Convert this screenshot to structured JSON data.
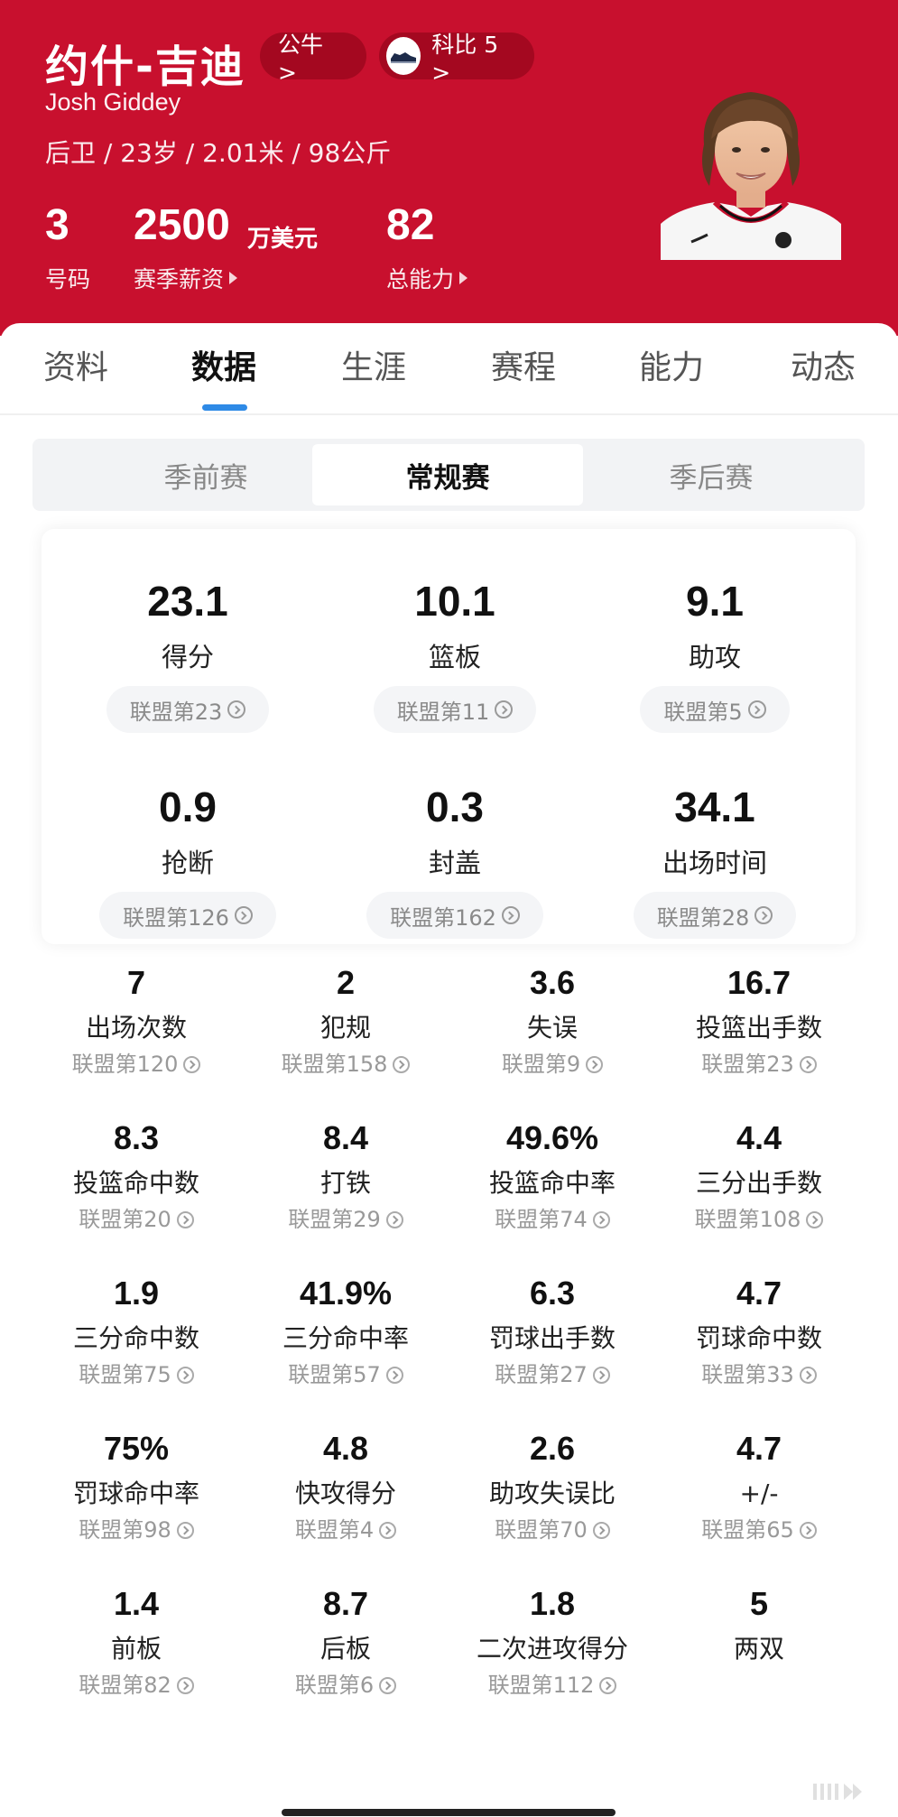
{
  "player": {
    "name_cn": "约什-吉迪",
    "name_en": "Josh Giddey",
    "team_chip": "公牛 >",
    "shoe_chip": "科比 5 >",
    "bio": "后卫 / 23岁 / 2.01米 / 98公斤",
    "number": "3",
    "number_label": "号码",
    "salary": "2500",
    "salary_unit": "万美元",
    "salary_label": "赛季薪资",
    "rating": "82",
    "rating_label": "总能力",
    "brand_color": "#c8102e"
  },
  "tabs": [
    "资料",
    "数据",
    "生涯",
    "赛程",
    "能力",
    "动态"
  ],
  "active_tab": "数据",
  "season_types": [
    "季前赛",
    "常规赛",
    "季后赛"
  ],
  "active_season_type": "常规赛",
  "main_stats": [
    {
      "value": "23.1",
      "label": "得分",
      "rank": "联盟第23"
    },
    {
      "value": "10.1",
      "label": "篮板",
      "rank": "联盟第11"
    },
    {
      "value": "9.1",
      "label": "助攻",
      "rank": "联盟第5"
    },
    {
      "value": "0.9",
      "label": "抢断",
      "rank": "联盟第126"
    },
    {
      "value": "0.3",
      "label": "封盖",
      "rank": "联盟第162"
    },
    {
      "value": "34.1",
      "label": "出场时间",
      "rank": "联盟第28"
    }
  ],
  "detail_stats": [
    {
      "value": "7",
      "label": "出场次数",
      "rank": "联盟第120"
    },
    {
      "value": "2",
      "label": "犯规",
      "rank": "联盟第158"
    },
    {
      "value": "3.6",
      "label": "失误",
      "rank": "联盟第9"
    },
    {
      "value": "16.7",
      "label": "投篮出手数",
      "rank": "联盟第23"
    },
    {
      "value": "8.3",
      "label": "投篮命中数",
      "rank": "联盟第20"
    },
    {
      "value": "8.4",
      "label": "打铁",
      "rank": "联盟第29"
    },
    {
      "value": "49.6%",
      "label": "投篮命中率",
      "rank": "联盟第74"
    },
    {
      "value": "4.4",
      "label": "三分出手数",
      "rank": "联盟第108"
    },
    {
      "value": "1.9",
      "label": "三分命中数",
      "rank": "联盟第75"
    },
    {
      "value": "41.9%",
      "label": "三分命中率",
      "rank": "联盟第57"
    },
    {
      "value": "6.3",
      "label": "罚球出手数",
      "rank": "联盟第27"
    },
    {
      "value": "4.7",
      "label": "罚球命中数",
      "rank": "联盟第33"
    },
    {
      "value": "75%",
      "label": "罚球命中率",
      "rank": "联盟第98"
    },
    {
      "value": "4.8",
      "label": "快攻得分",
      "rank": "联盟第4"
    },
    {
      "value": "2.6",
      "label": "助攻失误比",
      "rank": "联盟第70"
    },
    {
      "value": "4.7",
      "label": "+/-",
      "rank": "联盟第65"
    },
    {
      "value": "1.4",
      "label": "前板",
      "rank": "联盟第82"
    },
    {
      "value": "8.7",
      "label": "后板",
      "rank": "联盟第6"
    },
    {
      "value": "1.8",
      "label": "二次进攻得分",
      "rank": "联盟第112"
    },
    {
      "value": "5",
      "label": "两双",
      "rank": ""
    }
  ]
}
